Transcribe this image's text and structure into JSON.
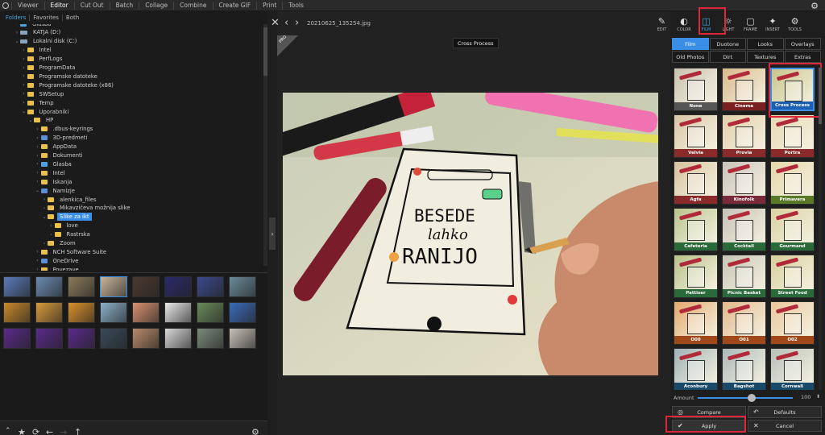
{
  "menu": {
    "items": [
      "Viewer",
      "Editor",
      "Cut Out",
      "Batch",
      "Collage",
      "Combine",
      "Create GIF",
      "Print",
      "Tools"
    ],
    "active": "Editor"
  },
  "folder_tabs": [
    "Folders",
    "Favorites",
    "Both"
  ],
  "tree": [
    {
      "label": "Glasba",
      "depth": 2,
      "icon": "music",
      "caret": "›"
    },
    {
      "label": "KATJA (D:)",
      "depth": 2,
      "icon": "drive",
      "caret": "›"
    },
    {
      "label": "Lokalni disk (C:)",
      "depth": 2,
      "icon": "drive",
      "caret": "⌄"
    },
    {
      "label": "Intel",
      "depth": 3,
      "icon": "folder",
      "caret": "›"
    },
    {
      "label": "PerfLogs",
      "depth": 3,
      "icon": "folder",
      "caret": "›"
    },
    {
      "label": "ProgramData",
      "depth": 3,
      "icon": "folder",
      "caret": "›"
    },
    {
      "label": "Programske datoteke",
      "depth": 3,
      "icon": "folder",
      "caret": "›"
    },
    {
      "label": "Programske datoteke (x86)",
      "depth": 3,
      "icon": "folder",
      "caret": "›"
    },
    {
      "label": "SWSetup",
      "depth": 3,
      "icon": "folder",
      "caret": "›"
    },
    {
      "label": "Temp",
      "depth": 3,
      "icon": "folder",
      "caret": "›"
    },
    {
      "label": "Uporabniki",
      "depth": 3,
      "icon": "folder",
      "caret": "⌄"
    },
    {
      "label": "HP",
      "depth": 4,
      "icon": "folder",
      "caret": "⌄"
    },
    {
      "label": ".dbus-keyrings",
      "depth": 5,
      "icon": "folder",
      "caret": "›"
    },
    {
      "label": "3D-predmeti",
      "depth": 5,
      "icon": "blue",
      "caret": "›"
    },
    {
      "label": "AppData",
      "depth": 5,
      "icon": "folder",
      "caret": "›"
    },
    {
      "label": "Dokumenti",
      "depth": 5,
      "icon": "folder",
      "caret": "›"
    },
    {
      "label": "Glasba",
      "depth": 5,
      "icon": "music",
      "caret": "›"
    },
    {
      "label": "Intel",
      "depth": 5,
      "icon": "folder",
      "caret": "›"
    },
    {
      "label": "Iskanja",
      "depth": 5,
      "icon": "folder",
      "caret": "›"
    },
    {
      "label": "Namizje",
      "depth": 5,
      "icon": "blue",
      "caret": "⌄"
    },
    {
      "label": "alenkica_files",
      "depth": 6,
      "icon": "folder",
      "caret": "›"
    },
    {
      "label": "Mikavzičeva možnija slike",
      "depth": 6,
      "icon": "folder",
      "caret": "›"
    },
    {
      "label": "Slike za ikt",
      "depth": 6,
      "icon": "folder",
      "caret": "⌄",
      "selected": true
    },
    {
      "label": "love",
      "depth": 7,
      "icon": "folder",
      "caret": "›"
    },
    {
      "label": "Rastrska",
      "depth": 7,
      "icon": "folder",
      "caret": "›"
    },
    {
      "label": "Zoom",
      "depth": 6,
      "icon": "folder",
      "caret": "›"
    },
    {
      "label": "NCH Software Suite",
      "depth": 5,
      "icon": "folder",
      "caret": "›"
    },
    {
      "label": "OneDrive",
      "depth": 5,
      "icon": "blue",
      "caret": "›"
    },
    {
      "label": "Povezave",
      "depth": 5,
      "icon": "folder",
      "caret": "›"
    }
  ],
  "viewer": {
    "filename": "20210625_135254.jpg",
    "tooltip": "Cross Process",
    "badge": "PRO"
  },
  "tools": [
    {
      "label": "EDIT",
      "icon": "edit-icon",
      "glyph": "✎"
    },
    {
      "label": "COLOR",
      "icon": "color-icon",
      "glyph": "◐"
    },
    {
      "label": "FILM",
      "icon": "film-icon",
      "glyph": "◫",
      "active": true
    },
    {
      "label": "LIGHT",
      "icon": "light-icon",
      "glyph": "☼"
    },
    {
      "label": "FRAME",
      "icon": "frame-icon",
      "glyph": "▢"
    },
    {
      "label": "INSERT",
      "icon": "insert-icon",
      "glyph": "✦"
    },
    {
      "label": "TOOLS",
      "icon": "tools-icon",
      "glyph": "⚙"
    }
  ],
  "film_tabs_row1": [
    "Film",
    "Duotone",
    "Looks",
    "Overlays"
  ],
  "film_tabs_row2": [
    "Old Photos",
    "Dirt",
    "Textures",
    "Extras"
  ],
  "film_active_tab": "Film",
  "presets": [
    {
      "label": "None",
      "tint": "#c9c2b0",
      "label_bg": "#555"
    },
    {
      "label": "Cinema",
      "tint": "#d8b98a",
      "label_bg": "#7a2020"
    },
    {
      "label": "Cross Process",
      "tint": "#c8c68a",
      "label_bg": "#1d5fae",
      "selected": true
    },
    {
      "label": "Velvia",
      "tint": "#d9c7a8",
      "label_bg": "#8a2a2a"
    },
    {
      "label": "Provia",
      "tint": "#e2cfa9",
      "label_bg": "#8a2a2a"
    },
    {
      "label": "Portra",
      "tint": "#e7d9b3",
      "label_bg": "#8a2a2a"
    },
    {
      "label": "Agfa",
      "tint": "#d7c39d",
      "label_bg": "#8a2a2a"
    },
    {
      "label": "Kinofolk",
      "tint": "#c9c3b9",
      "label_bg": "#7a2a3a"
    },
    {
      "label": "Primavera",
      "tint": "#e5d7a8",
      "label_bg": "#5a7a2a"
    },
    {
      "label": "Cafeteria",
      "tint": "#b8c48c",
      "label_bg": "#2a6a3a"
    },
    {
      "label": "Cocktail",
      "tint": "#c5c2b6",
      "label_bg": "#2a6a3a"
    },
    {
      "label": "Gourmand",
      "tint": "#d9d1a2",
      "label_bg": "#2a6a3a"
    },
    {
      "label": "Pattiser",
      "tint": "#b9c28a",
      "label_bg": "#2a6a3a"
    },
    {
      "label": "Picnic Basket",
      "tint": "#c6c5b4",
      "label_bg": "#2a6a3a"
    },
    {
      "label": "Street Food",
      "tint": "#d9cf9a",
      "label_bg": "#2a6a3a"
    },
    {
      "label": "O00",
      "tint": "#e2a96c",
      "label_bg": "#a0481a"
    },
    {
      "label": "O01",
      "tint": "#e3b88a",
      "label_bg": "#a0481a"
    },
    {
      "label": "O02",
      "tint": "#e9c79a",
      "label_bg": "#a0481a"
    },
    {
      "label": "Aconbury",
      "tint": "#9fb2b6",
      "label_bg": "#1a4a6a"
    },
    {
      "label": "Bagshot",
      "tint": "#a9b9b8",
      "label_bg": "#1a4a6a"
    },
    {
      "label": "Cornwall",
      "tint": "#b8c0b8",
      "label_bg": "#1a4a6a"
    }
  ],
  "amount": {
    "label": "Amount",
    "value": "100",
    "level": 100
  },
  "buttons": {
    "compare": "Compare",
    "defaults": "Defaults",
    "apply": "Apply",
    "cancel": "Cancel"
  },
  "thumbnails": [
    "#5a7ab8",
    "#6a8ab0",
    "#8a7a5a",
    "#c9b39a",
    "#4a3a30",
    "#2a2a6a",
    "#3a4a8a",
    "#6a8a9a",
    "#c8882a",
    "#d89a3a",
    "#d8902a",
    "#8ab0c8",
    "#d89070",
    "#e8e8e8",
    "#6a8a5a",
    "#3a6ab8",
    "#5a2a8a",
    "#5a2a8a",
    "#5a2a8a",
    "#3a4a5a",
    "#b88a6a",
    "#d8d8d8",
    "#7a8a7a",
    "#c8c0b8"
  ],
  "colors": {
    "accent": "#3a8ee6",
    "highlight": "#e0263a"
  }
}
